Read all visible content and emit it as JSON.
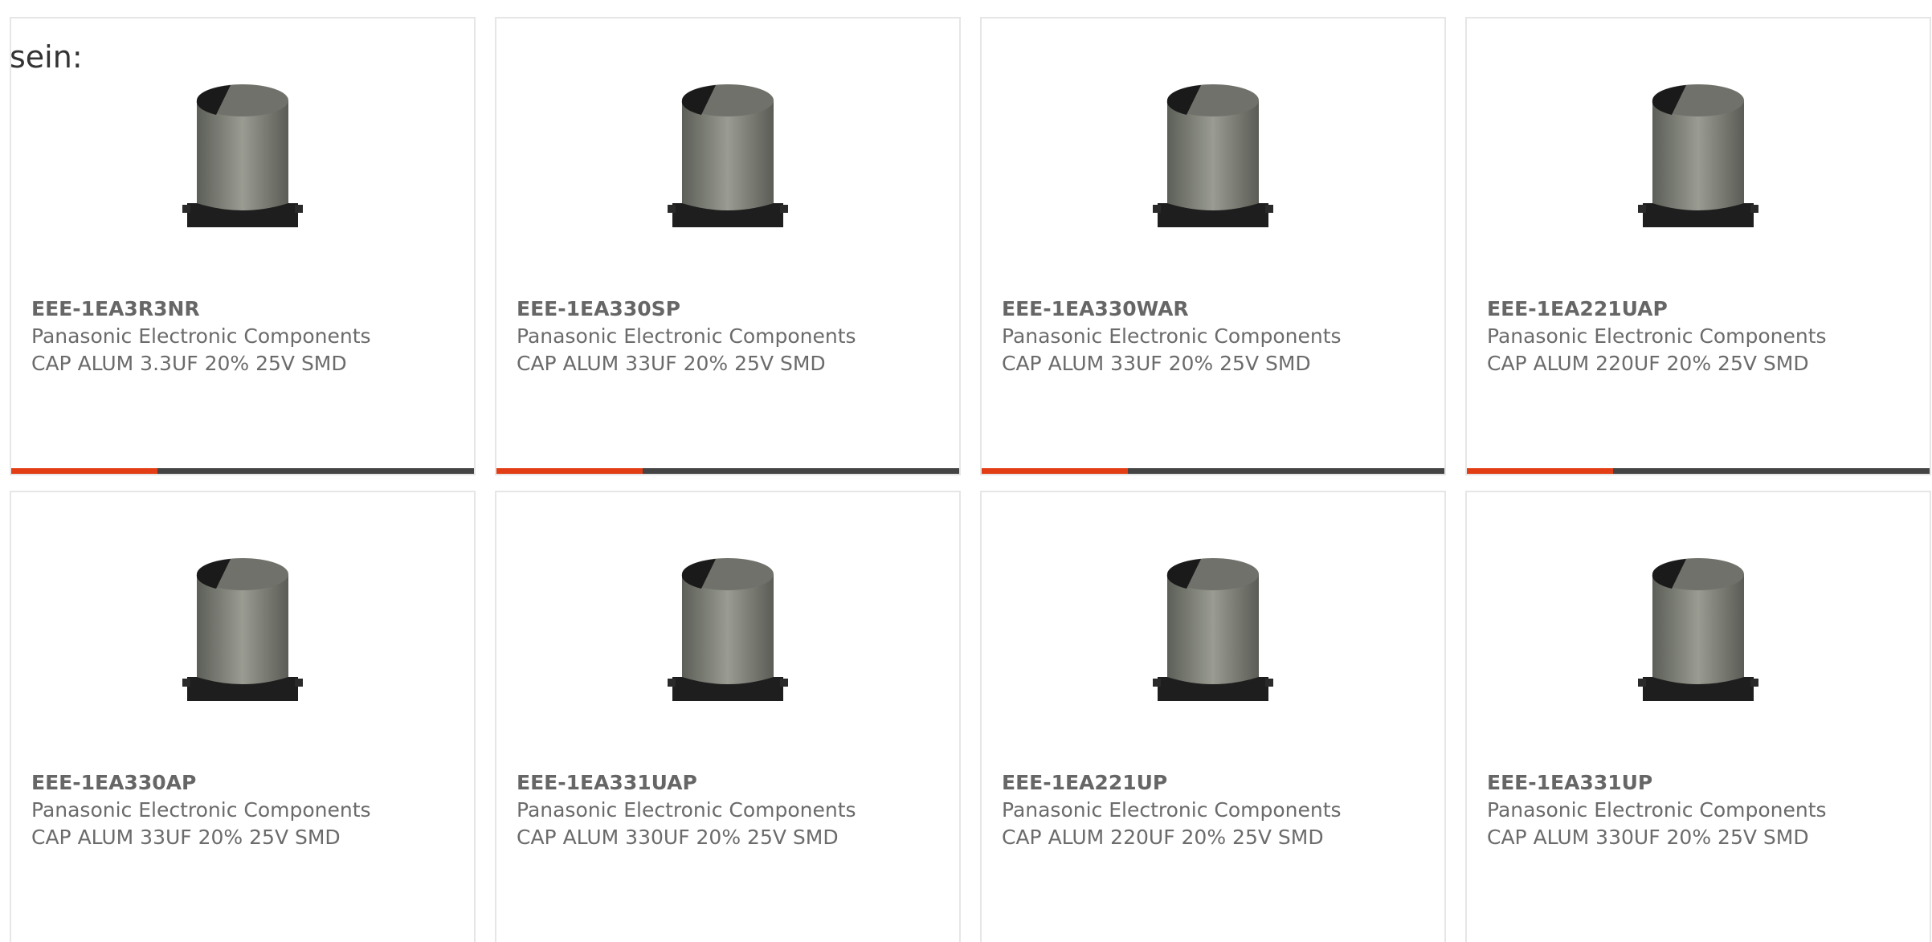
{
  "intro_text": "sein:",
  "colors": {
    "accent": "#e23d14",
    "bar": "#444444",
    "border": "#e6e6e6",
    "text": "#666666"
  },
  "products": [
    {
      "part": "EEE-1EA3R3NR",
      "manufacturer": "Panasonic Electronic Components",
      "description": "CAP ALUM 3.3UF 20% 25V SMD",
      "icon": "smd-capacitor-icon"
    },
    {
      "part": "EEE-1EA330SP",
      "manufacturer": "Panasonic Electronic Components",
      "description": "CAP ALUM 33UF 20% 25V SMD",
      "icon": "smd-capacitor-icon"
    },
    {
      "part": "EEE-1EA330WAR",
      "manufacturer": "Panasonic Electronic Components",
      "description": "CAP ALUM 33UF 20% 25V SMD",
      "icon": "smd-capacitor-icon"
    },
    {
      "part": "EEE-1EA221UAP",
      "manufacturer": "Panasonic Electronic Components",
      "description": "CAP ALUM 220UF 20% 25V SMD",
      "icon": "smd-capacitor-icon"
    },
    {
      "part": "EEE-1EA330AP",
      "manufacturer": "Panasonic Electronic Components",
      "description": "CAP ALUM 33UF 20% 25V SMD",
      "icon": "smd-capacitor-icon"
    },
    {
      "part": "EEE-1EA331UAP",
      "manufacturer": "Panasonic Electronic Components",
      "description": "CAP ALUM 330UF 20% 25V SMD",
      "icon": "smd-capacitor-icon"
    },
    {
      "part": "EEE-1EA221UP",
      "manufacturer": "Panasonic Electronic Components",
      "description": "CAP ALUM 220UF 20% 25V SMD",
      "icon": "smd-capacitor-icon"
    },
    {
      "part": "EEE-1EA331UP",
      "manufacturer": "Panasonic Electronic Components",
      "description": "CAP ALUM 330UF 20% 25V SMD",
      "icon": "smd-capacitor-icon"
    }
  ]
}
